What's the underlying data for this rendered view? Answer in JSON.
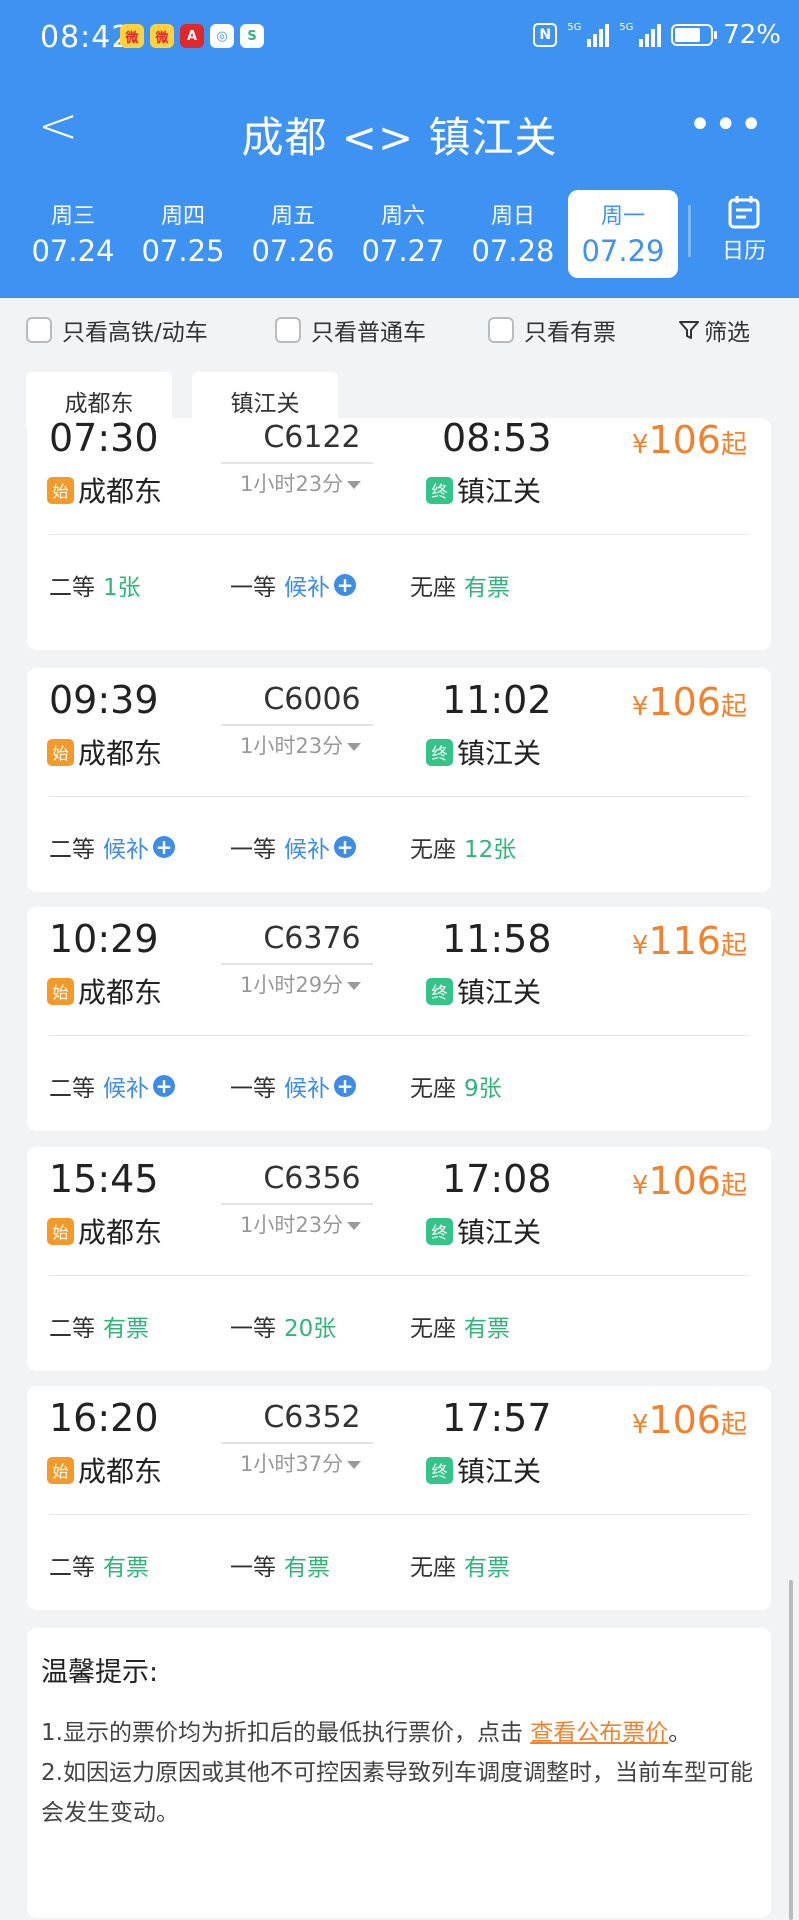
{
  "status": {
    "time": "08:42",
    "battery": "72%",
    "battery_level": 0.72,
    "app_icons": [
      "微",
      "微",
      "A",
      "◎",
      "S"
    ],
    "nfc": "N",
    "sig1": "5G",
    "sig2": "5G"
  },
  "header": {
    "title": "成都 <> 镇江关",
    "back": "<",
    "more": "•••"
  },
  "dates": [
    {
      "weekday": "周三",
      "date": "07.24"
    },
    {
      "weekday": "周四",
      "date": "07.25"
    },
    {
      "weekday": "周五",
      "date": "07.26"
    },
    {
      "weekday": "周六",
      "date": "07.27"
    },
    {
      "weekday": "周日",
      "date": "07.28"
    },
    {
      "weekday": "周一",
      "date": "07.29",
      "selected": true
    }
  ],
  "calendar": {
    "label": "日历"
  },
  "filters": {
    "high_speed": "只看高铁/动车",
    "normal": "只看普通车",
    "available": "只看有票",
    "filter": "筛选"
  },
  "stations": {
    "from": "成都东",
    "to": "镇江关"
  },
  "trains": [
    {
      "dep": "07:30",
      "number": "C6122",
      "arr": "08:53",
      "duration": "1小时23分",
      "price": "106",
      "from": "成都东",
      "to": "镇江关",
      "from_badge": "始",
      "to_badge": "终",
      "seats": [
        {
          "class": "二等",
          "value": "1张",
          "type": "g"
        },
        {
          "class": "一等",
          "value": "候补",
          "type": "b"
        },
        {
          "class": "无座",
          "value": "有票",
          "type": "g"
        }
      ]
    },
    {
      "dep": "09:39",
      "number": "C6006",
      "arr": "11:02",
      "duration": "1小时23分",
      "price": "106",
      "from": "成都东",
      "to": "镇江关",
      "from_badge": "始",
      "to_badge": "终",
      "seats": [
        {
          "class": "二等",
          "value": "候补",
          "type": "b"
        },
        {
          "class": "一等",
          "value": "候补",
          "type": "b"
        },
        {
          "class": "无座",
          "value": "12张",
          "type": "g"
        }
      ]
    },
    {
      "dep": "10:29",
      "number": "C6376",
      "arr": "11:58",
      "duration": "1小时29分",
      "price": "116",
      "from": "成都东",
      "to": "镇江关",
      "from_badge": "始",
      "to_badge": "终",
      "seats": [
        {
          "class": "二等",
          "value": "候补",
          "type": "b"
        },
        {
          "class": "一等",
          "value": "候补",
          "type": "b"
        },
        {
          "class": "无座",
          "value": "9张",
          "type": "g"
        }
      ]
    },
    {
      "dep": "15:45",
      "number": "C6356",
      "arr": "17:08",
      "duration": "1小时23分",
      "price": "106",
      "from": "成都东",
      "to": "镇江关",
      "from_badge": "始",
      "to_badge": "终",
      "seats": [
        {
          "class": "二等",
          "value": "有票",
          "type": "g"
        },
        {
          "class": "一等",
          "value": "20张",
          "type": "g"
        },
        {
          "class": "无座",
          "value": "有票",
          "type": "g"
        }
      ]
    },
    {
      "dep": "16:20",
      "number": "C6352",
      "arr": "17:57",
      "duration": "1小时37分",
      "price": "106",
      "from": "成都东",
      "to": "镇江关",
      "from_badge": "始",
      "to_badge": "终",
      "seats": [
        {
          "class": "二等",
          "value": "有票",
          "type": "g"
        },
        {
          "class": "一等",
          "value": "有票",
          "type": "g"
        },
        {
          "class": "无座",
          "value": "有票",
          "type": "g"
        }
      ]
    }
  ],
  "price_prefix": "¥",
  "price_suffix": "起",
  "tips": {
    "title": "温馨提示:",
    "line1_pre": "1.显示的票价均为折扣后的最低执行票价，点击 ",
    "line1_link": "查看公布票价",
    "line1_post": "。",
    "line2": "2.如因运力原因或其他不可控因素导致列车调度调整时，当前车型可能会发生变动。"
  },
  "colors": {
    "primary": "#3d92f2",
    "price": "#f0822d",
    "available": "#2fb57a",
    "waitlist": "#3d8de6"
  }
}
